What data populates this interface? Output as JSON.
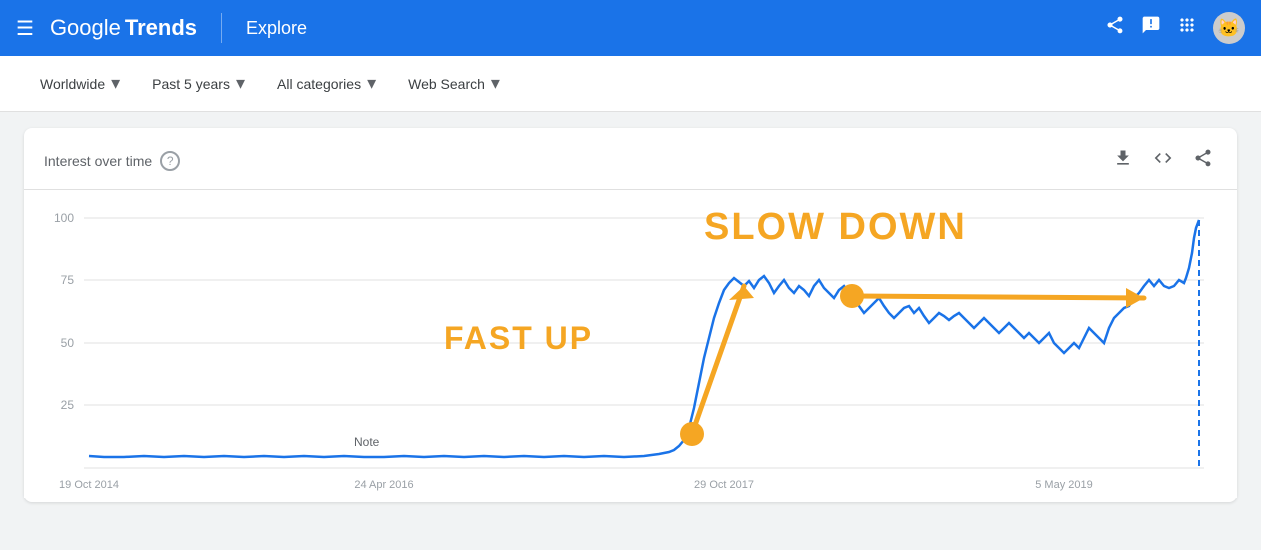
{
  "header": {
    "menu_icon": "☰",
    "logo_google": "Google",
    "logo_trends": "Trends",
    "divider": "|",
    "explore": "Explore",
    "share_icon": "share",
    "feedback_icon": "feedback",
    "apps_icon": "apps",
    "avatar_icon": "👤"
  },
  "toolbar": {
    "worldwide_label": "Worldwide",
    "time_label": "Past 5 years",
    "categories_label": "All categories",
    "search_type_label": "Web Search",
    "dropdown_arrow": "▾"
  },
  "chart": {
    "title": "Interest over time",
    "help": "?",
    "download_icon": "⬇",
    "embed_icon": "<>",
    "share_icon": "share",
    "annotation_slow_down": "SLOW DOWN",
    "annotation_fast_up": "FAST UP",
    "x_labels": [
      "19 Oct 2014",
      "24 Apr 2016",
      "29 Oct 2017",
      "5 May 2019"
    ],
    "y_labels": [
      "100",
      "75",
      "50",
      "25"
    ],
    "note_label": "Note"
  }
}
